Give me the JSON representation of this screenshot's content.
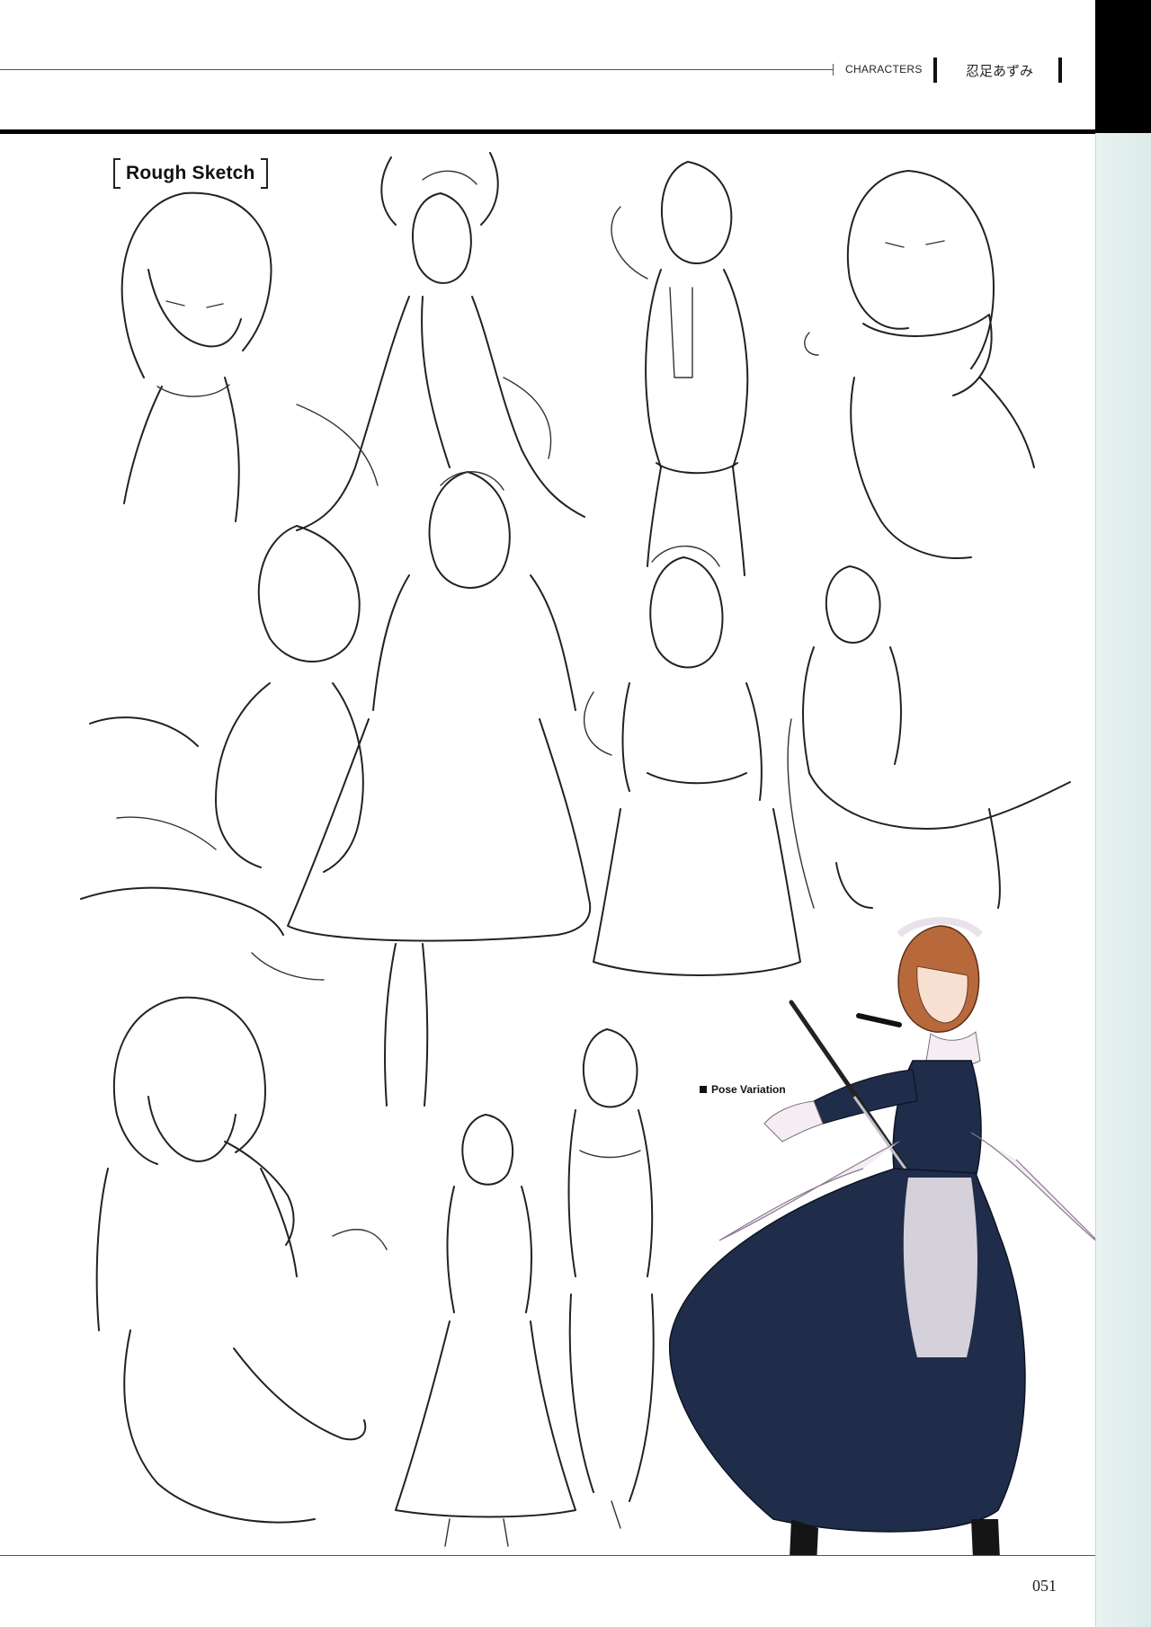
{
  "header": {
    "section": "CHARACTERS",
    "character_name": "忍足あずみ"
  },
  "content": {
    "rough_sketch_title": "Rough Sketch",
    "pose_variation_label": "Pose Variation"
  },
  "footer": {
    "page_number": "051"
  },
  "colors": {
    "side_strip": "#dcebe8",
    "dress": "#1f2d4a",
    "hair": "#b8693c",
    "apron": "#f4eef3"
  }
}
